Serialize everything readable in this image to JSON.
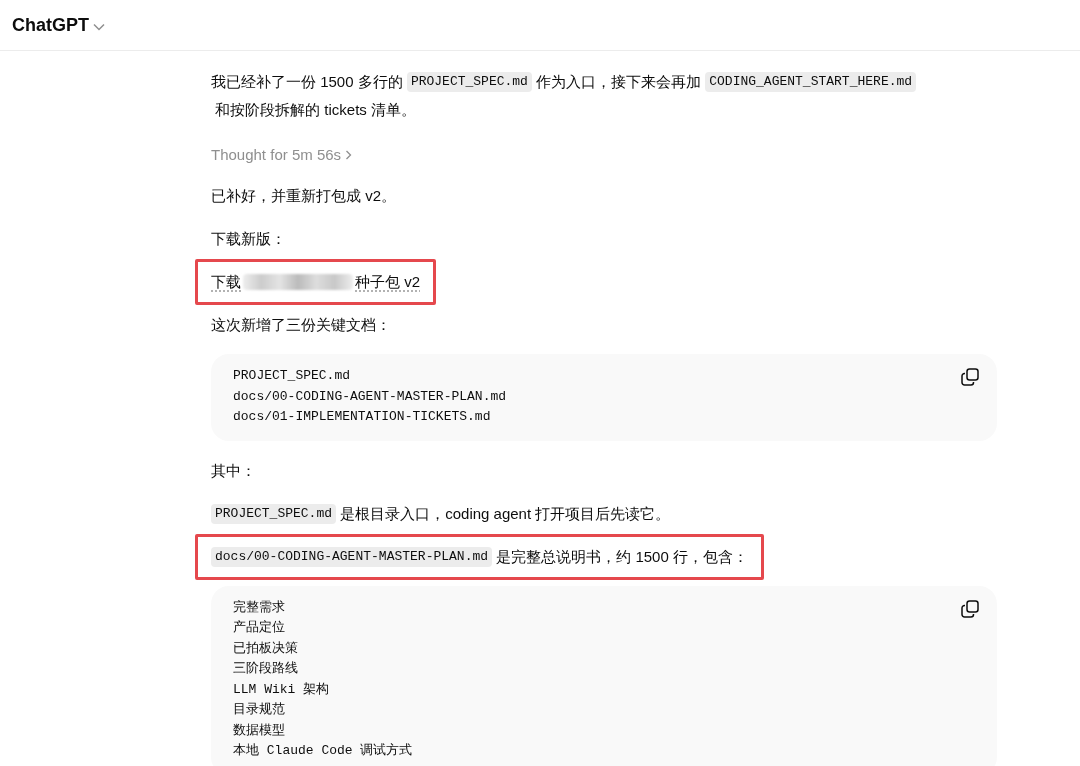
{
  "header": {
    "title": "ChatGPT"
  },
  "blocks": [
    {
      "kind": "paragraph",
      "highlight": false,
      "segments": [
        {
          "text": "我已经补了一份 1500 多行的 ",
          "code": false
        },
        {
          "text": "PROJECT_SPEC.md",
          "code": true
        },
        {
          "text": " 作为入口，接下来会再加 ",
          "code": false
        },
        {
          "text": "CODING_AGENT_START_HERE.md",
          "code": true
        },
        {
          "text": " 和按阶段拆解的 tickets 清单。",
          "code": false
        }
      ]
    },
    {
      "kind": "thought",
      "text": "Thought for 5m 56s"
    },
    {
      "kind": "paragraph",
      "highlight": false,
      "segments": [
        {
          "text": "已补好，并重新打包成 v2。",
          "code": false
        }
      ]
    },
    {
      "kind": "paragraph",
      "highlight": false,
      "segments": [
        {
          "text": "下载新版：",
          "code": false
        }
      ]
    },
    {
      "kind": "link",
      "highlight": true,
      "before": "下载",
      "after": "种子包 v2"
    },
    {
      "kind": "paragraph",
      "highlight": false,
      "segments": [
        {
          "text": "这次新增了三份关键文档：",
          "code": false
        }
      ]
    },
    {
      "kind": "code",
      "lines": [
        "PROJECT_SPEC.md",
        "docs/00-CODING-AGENT-MASTER-PLAN.md",
        "docs/01-IMPLEMENTATION-TICKETS.md"
      ]
    },
    {
      "kind": "paragraph",
      "highlight": false,
      "segments": [
        {
          "text": "其中：",
          "code": false
        }
      ]
    },
    {
      "kind": "paragraph",
      "highlight": false,
      "segments": [
        {
          "text": "PROJECT_SPEC.md",
          "code": true
        },
        {
          "text": " 是根目录入口，coding agent 打开项目后先读它。",
          "code": false
        }
      ]
    },
    {
      "kind": "paragraph",
      "highlight": true,
      "segments": [
        {
          "text": "docs/00-CODING-AGENT-MASTER-PLAN.md",
          "code": true
        },
        {
          "text": " 是完整总说明书，约 1500 行，包含：",
          "code": false
        }
      ]
    },
    {
      "kind": "code",
      "lines": [
        "完整需求",
        "产品定位",
        "已拍板决策",
        "三阶段路线",
        "LLM Wiki 架构",
        "目录规范",
        "数据模型",
        "本地 Claude Code 调试方式"
      ]
    }
  ]
}
